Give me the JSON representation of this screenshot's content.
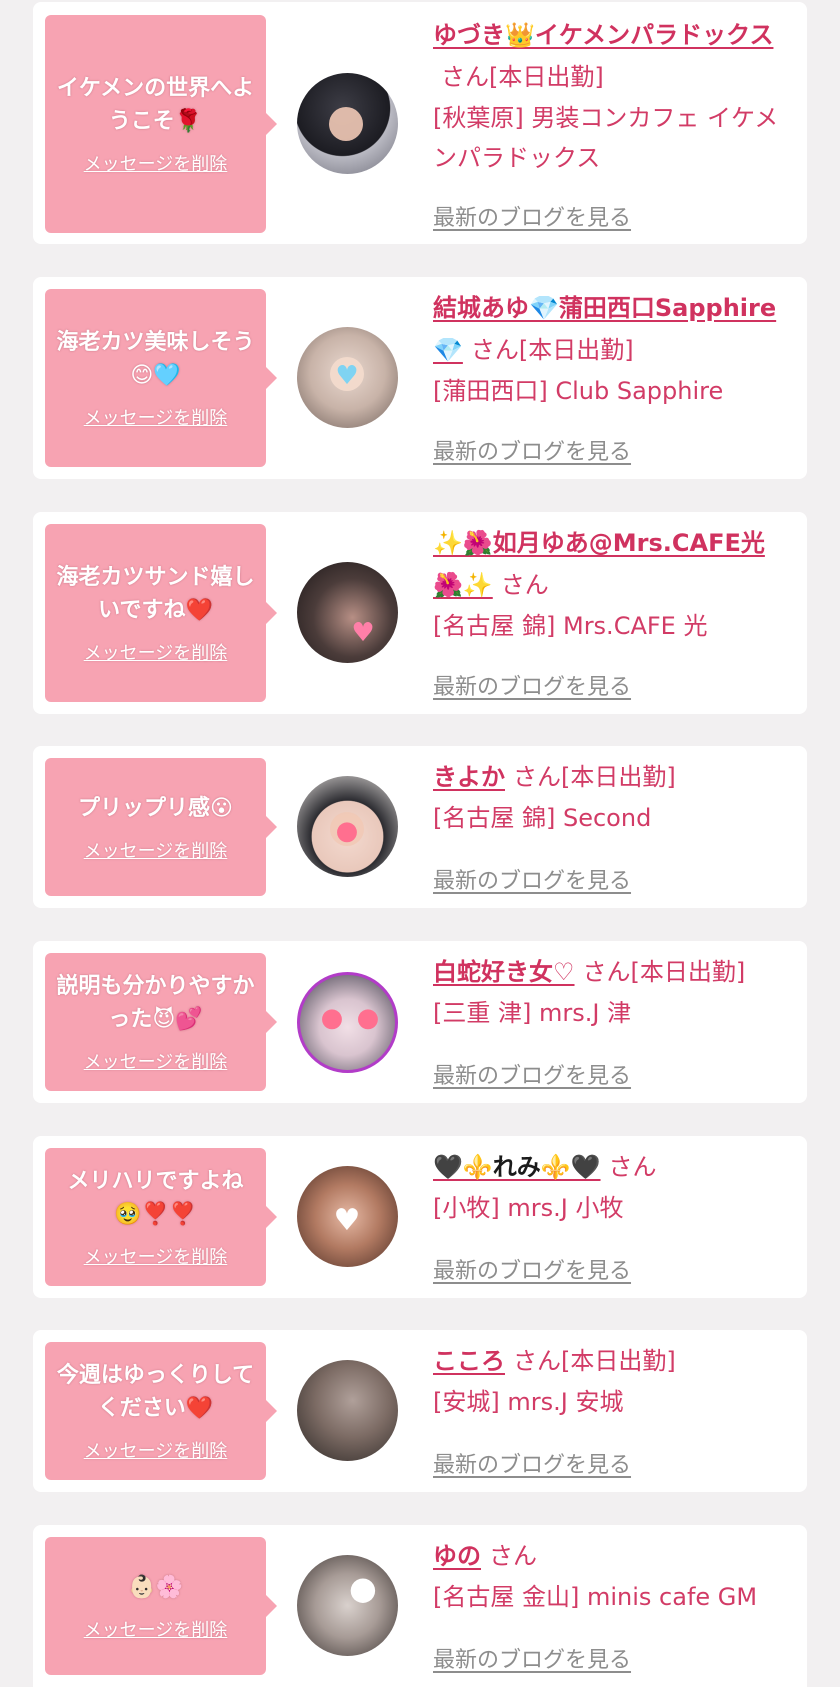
{
  "theme": {
    "bubble_color": "#f7a3b2",
    "name_color": "#d0325f",
    "text_color": "#d23b66",
    "link_gray": "#8d8d8d",
    "page_bg": "#f2f0f1",
    "card_bg": "#ffffff"
  },
  "delete_label": "メッセージを削除",
  "blog_label": "最新のブログを見る",
  "entries": [
    {
      "message": "イケメンの世界へようこそ🌹",
      "avatar_icon": "avatar-photo",
      "name": "ゆづき👑イケメンパラドックス",
      "suffix": "さん[本日出勤]",
      "shop": "[秋葉原] 男装コンカフェ イケメンパラドックス"
    },
    {
      "message": "海老カツ美味しそう😊🩵",
      "avatar_icon": "avatar-photo",
      "name": "結城あゆ💎蒲田西口Sapphire💎",
      "suffix": "さん[本日出勤]",
      "shop": "[蒲田西口] Club Sapphire"
    },
    {
      "message": "海老カツサンド嬉しいですね❤️",
      "avatar_icon": "avatar-photo",
      "name": "✨🌺如月ゆあ@Mrs.CAFE光🌺✨",
      "suffix": "さん",
      "shop": "[名古屋 錦] Mrs.CAFE 光"
    },
    {
      "message": "プリップリ感😮",
      "avatar_icon": "avatar-photo",
      "name": "きよか",
      "suffix": "さん[本日出勤]",
      "shop": "[名古屋 錦] Second"
    },
    {
      "message": "説明も分かりやすかった😈💕",
      "avatar_icon": "avatar-photo",
      "name": "白蛇好き女♡",
      "suffix": "さん[本日出勤]",
      "shop": "[三重 津] mrs.J 津"
    },
    {
      "message": "メリハリですよね🥹❣️❣️",
      "avatar_icon": "avatar-photo",
      "name": "🖤⚜️れみ⚜️🖤",
      "suffix": "さん",
      "shop": "[小牧] mrs.J 小牧"
    },
    {
      "message": "今週はゆっくりしてください❤️",
      "avatar_icon": "avatar-photo",
      "name": "こころ",
      "suffix": "さん[本日出勤]",
      "shop": "[安城] mrs.J 安城"
    },
    {
      "message": "👶🏻🌸",
      "avatar_icon": "avatar-photo",
      "name": "ゆの",
      "suffix": "さん",
      "shop": "[名古屋 金山] minis cafe GM"
    }
  ]
}
